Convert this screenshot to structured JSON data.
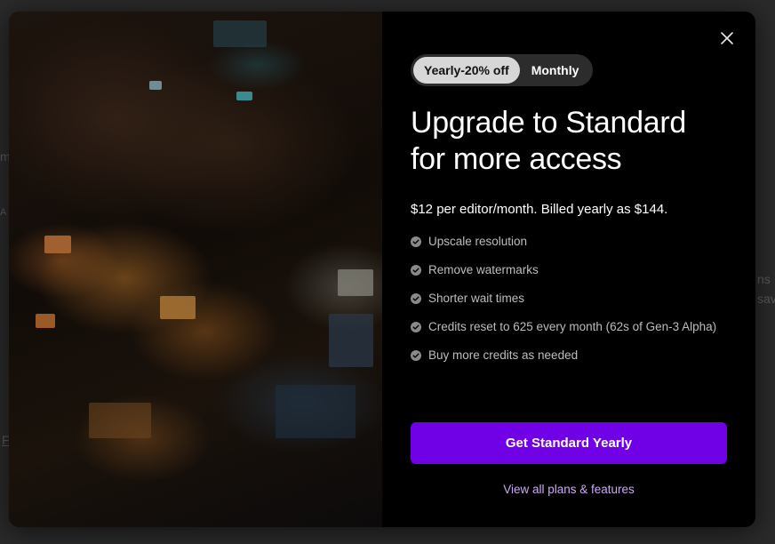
{
  "background": {
    "fragments": [
      "m",
      "A",
      "ns",
      "sav",
      "F"
    ]
  },
  "modal": {
    "close_icon": "close-icon",
    "billing_toggle": {
      "options": [
        "Yearly-20% off",
        "Monthly"
      ],
      "selected": "Yearly-20% off"
    },
    "headline": "Upgrade to Standard for more access",
    "price_text": "$12 per editor/month. Billed yearly as $144.",
    "features": [
      "Upscale resolution",
      "Remove watermarks",
      "Shorter wait times",
      "Credits reset to 625 every month (62s of Gen-3 Alpha)",
      "Buy more credits as needed"
    ],
    "cta_label": "Get Standard Yearly",
    "link_label": "View all plans & features"
  },
  "colors": {
    "accent": "#7000e6",
    "link": "#c9a9f5"
  }
}
